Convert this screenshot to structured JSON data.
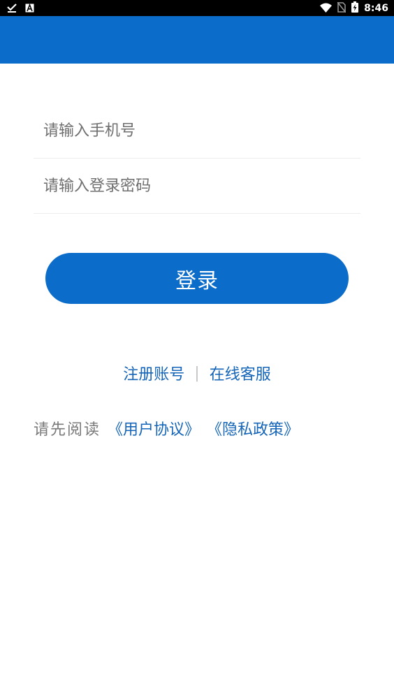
{
  "status_bar": {
    "time": "8:46",
    "left_icons": [
      "download-done-icon",
      "a-box-icon"
    ],
    "right_icons": [
      "wifi-icon",
      "no-sim-icon",
      "battery-charging-icon"
    ]
  },
  "login_form": {
    "phone_placeholder": "请输入手机号",
    "phone_value": "",
    "password_placeholder": "请输入登录密码",
    "password_value": "",
    "login_label": "登录"
  },
  "links": {
    "register": "注册账号",
    "divider": "|",
    "customer_service": "在线客服"
  },
  "agreement": {
    "prefix": "请先阅读",
    "user_agreement": "《用户协议》",
    "privacy_policy": "《隐私政策》"
  },
  "colors": {
    "primary": "#0c6cc9",
    "link": "#1565b8",
    "status_bar": "#000000",
    "placeholder": "#6f6f6f"
  }
}
